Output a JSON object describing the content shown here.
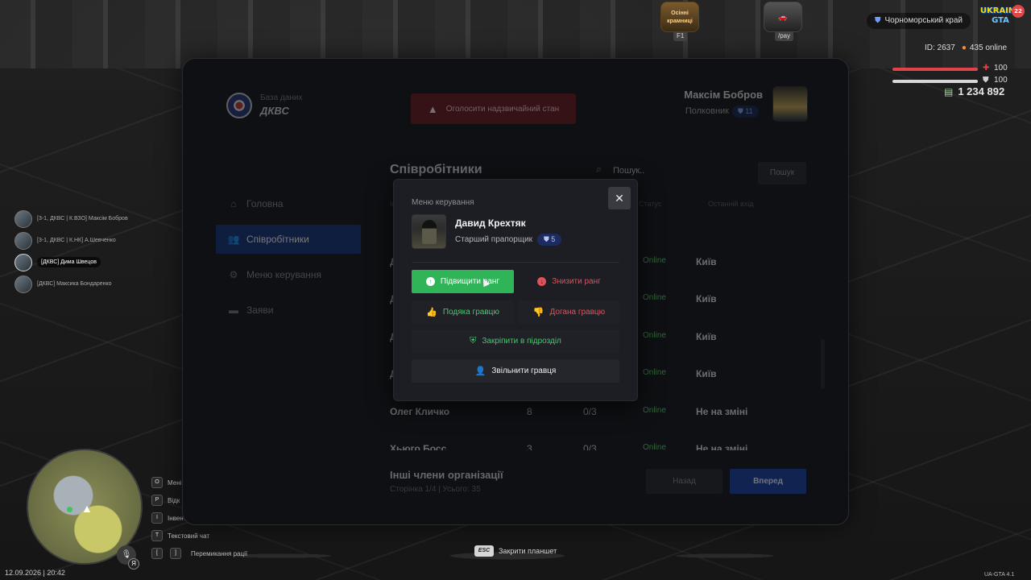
{
  "hud": {
    "shop_label": "Осінні крамниці",
    "shop_key": "F1",
    "pay_key": "/pay",
    "region": "Чорноморський край",
    "logo_main": "UKRAINE",
    "logo_sub": "GTA",
    "logo_badge": "22",
    "player_id": "ID: 2637",
    "online": "435 online",
    "health": "100",
    "armor": "100",
    "money": "1 234 892"
  },
  "voice_list": [
    {
      "name": "[3-1, ДКВС | К.ВЗО] Максім Бобров",
      "active": false
    },
    {
      "name": "[3-1, ДКВС | К.НК] А.Шевченко",
      "active": false
    },
    {
      "name": "[ДКВС] Дима Швецов",
      "active": true
    },
    {
      "name": "[ДКВС] Максика Бондаренко",
      "active": false
    }
  ],
  "hotkeys": [
    {
      "key": "O",
      "label": "Мені"
    },
    {
      "key": "P",
      "label": "Відк"
    },
    {
      "key": "I",
      "label": "Інвент."
    },
    {
      "key": "T",
      "label": "Текстовий чат"
    },
    {
      "key": "[",
      "key2": "]",
      "label": "Перемикання рації"
    }
  ],
  "footer": {
    "datetime": "12.09.2026 | 20:42",
    "esc_key": "ESC",
    "esc_label": "Закрити планшет",
    "version": "UA-GTA 4.1",
    "mic_badge": "Я"
  },
  "tablet": {
    "org_sub": "База даних",
    "org_name": "ДКВС",
    "emergency_label": "Оголосити надзвичайний стан",
    "user": {
      "name": "Максім Бобров",
      "rank": "Полковник",
      "rank_level": "11"
    },
    "nav": [
      {
        "label": "Головна",
        "icon": "home-icon",
        "active": false
      },
      {
        "label": "Співробітники",
        "icon": "users-icon",
        "active": true
      },
      {
        "label": "Меню керування",
        "icon": "gear-icon",
        "active": false
      },
      {
        "label": "Заяви",
        "icon": "folder-icon",
        "active": false
      }
    ],
    "section_title": "Співробітники",
    "search_placeholder": "Пошук..",
    "search_button": "Пошук",
    "columns": {
      "first": "Ім",
      "status": "Статус",
      "last_login": "Останній вхід"
    },
    "rows": [
      {
        "name": "Д",
        "rank": "",
        "warnings": "",
        "status": "Online",
        "last": "Київ"
      },
      {
        "name": "Д",
        "rank": "",
        "warnings": "",
        "status": "Online",
        "last": "Київ"
      },
      {
        "name": "Д",
        "rank": "",
        "warnings": "",
        "status": "Online",
        "last": "Київ"
      },
      {
        "name": "Д",
        "rank": "",
        "warnings": "",
        "status": "Online",
        "last": "Київ"
      },
      {
        "name": "Олег Кличко",
        "rank": "8",
        "warnings": "0/3",
        "status": "Online",
        "last": "Не на зміні"
      },
      {
        "name": "Хьюго Босс",
        "rank": "3",
        "warnings": "0/3",
        "status": "Online",
        "last": "Не на зміні"
      }
    ],
    "other_title": "Інші члени організації",
    "page_info": "Сторінка 1/4 | Усього: 35",
    "back_button": "Назад",
    "next_button": "Вперед"
  },
  "modal": {
    "label": "Меню керування",
    "target": {
      "name": "Давид Крехтяк",
      "rank": "Старший прапорщик",
      "rank_level": "5"
    },
    "promote": "Підвищити ранг",
    "demote": "Знизити ранг",
    "thanks": "Подяка гравцю",
    "reprimand": "Догана гравцю",
    "assign": "Закріпити в підрозділ",
    "fire": "Звільнити гравця"
  }
}
